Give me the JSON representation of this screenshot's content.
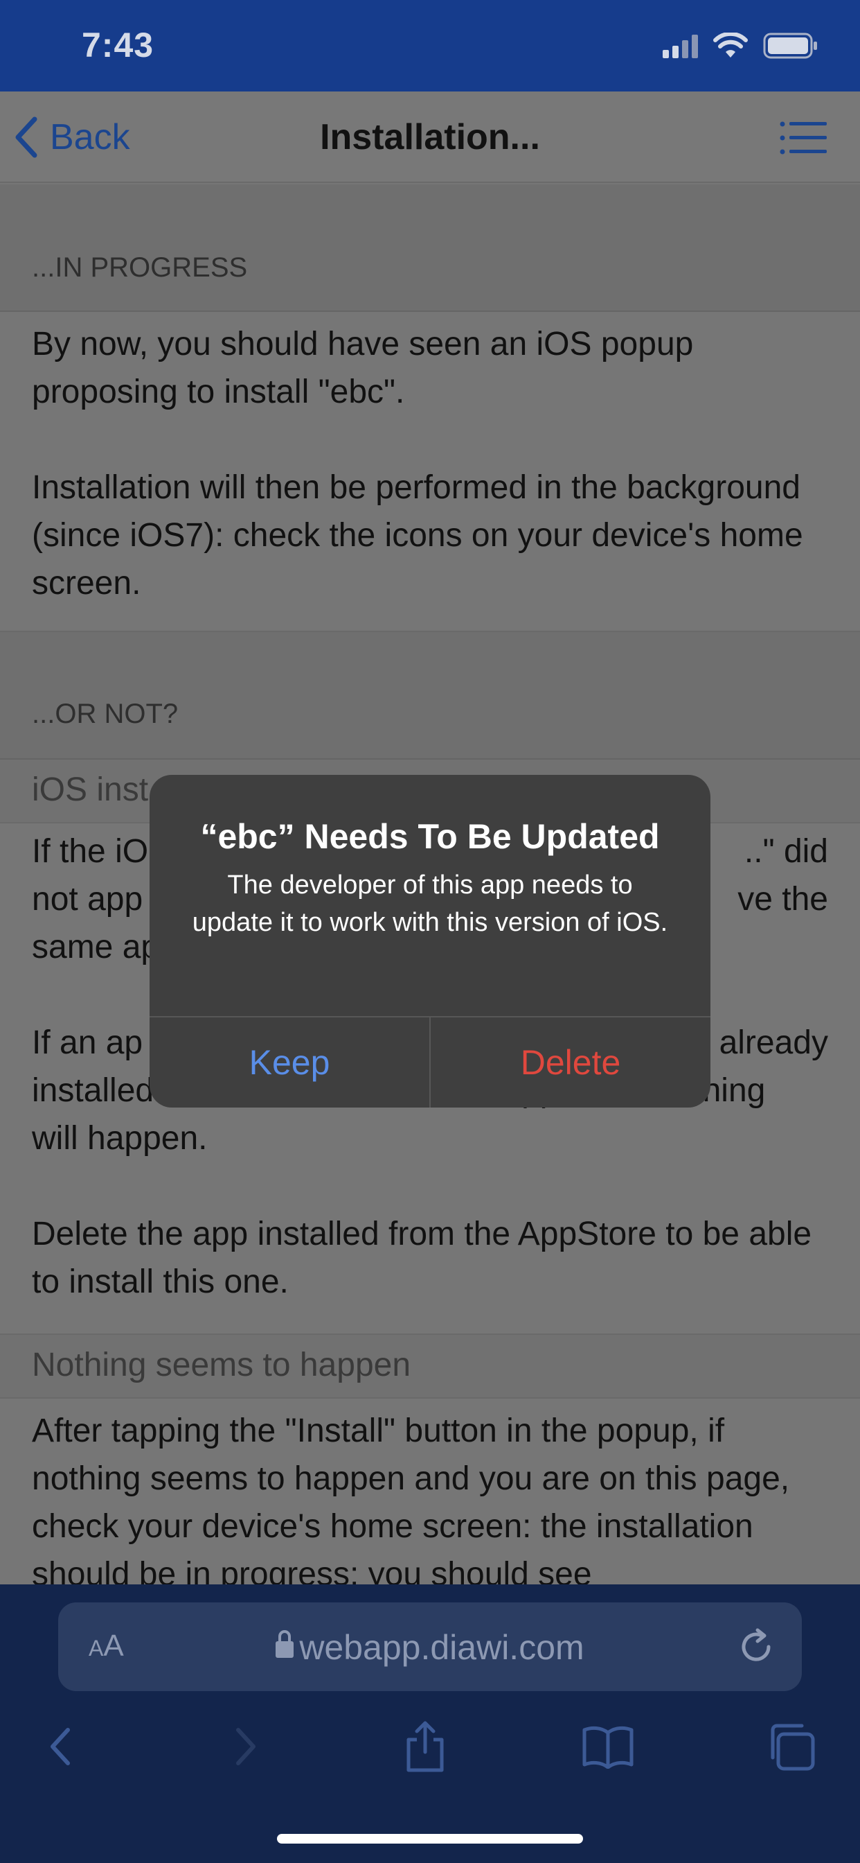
{
  "status_bar": {
    "time": "7:43",
    "icons": [
      "signal-icon",
      "wifi-icon",
      "battery-icon"
    ]
  },
  "navbar": {
    "back_label": "Back",
    "title": "Installation...",
    "menu_icon": "list-icon"
  },
  "content": {
    "section1_header": "...IN PROGRESS",
    "section1_p1": "By now, you should have seen an iOS popup proposing to install \"ebc\".",
    "section1_p2": "Installation will then be performed in the background (since iOS7): check the icons on your device's home screen.",
    "section2_header": "...OR NOT?",
    "subheader1": "iOS inst",
    "para2_line1_left": "If the iO",
    "para2_line1_right": "..\" did",
    "para2_line2_left": "not app",
    "para2_line2_right": "ve the",
    "para2_line3_left": "same ap",
    "para3_line1_left": "If an ap",
    "para3_line1_right": "already",
    "para3_line2": "installed on the device from the AppStore, nothing",
    "para3_line3": "will happen.",
    "para4": "Delete the app installed from the AppStore to be able to install this one.",
    "subheader2": "Nothing seems to happen",
    "para5": "After tapping the \"Install\" button in the popup, if nothing seems to happen and you are on this page, check your device's home screen: the installation should be in progress: you should see"
  },
  "alert": {
    "title": "“ebc” Needs To Be Updated",
    "message": "The developer of this app needs to update it to work with this version of iOS.",
    "keep_label": "Keep",
    "delete_label": "Delete",
    "keep_color": "#5a8ee8",
    "delete_color": "#e0483e"
  },
  "browser": {
    "aa_label_small": "A",
    "aa_label_large": "A",
    "url": "webapp.diawi.com",
    "toolbar_icons": [
      "back-arrow-icon",
      "forward-arrow-icon",
      "share-icon",
      "bookmarks-icon",
      "tabs-icon"
    ]
  },
  "colors": {
    "status_bar": "#163c8c",
    "browser_bar": "#13254c",
    "link_blue": "#1b458f"
  }
}
